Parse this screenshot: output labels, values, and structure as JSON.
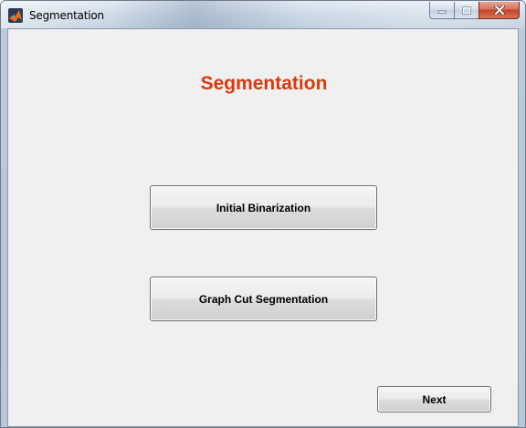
{
  "window": {
    "title": "Segmentation",
    "app_icon": "matlab-logo-icon"
  },
  "caption_buttons": {
    "minimize_icon": "minimize-icon",
    "maximize_icon": "maximize-icon",
    "close_icon": "close-icon"
  },
  "main": {
    "heading": "Segmentation",
    "heading_color": "#d93a0e",
    "buttons": {
      "initial_binarization": "Initial Binarization",
      "graph_cut_segmentation": "Graph Cut Segmentation",
      "next": "Next"
    }
  }
}
